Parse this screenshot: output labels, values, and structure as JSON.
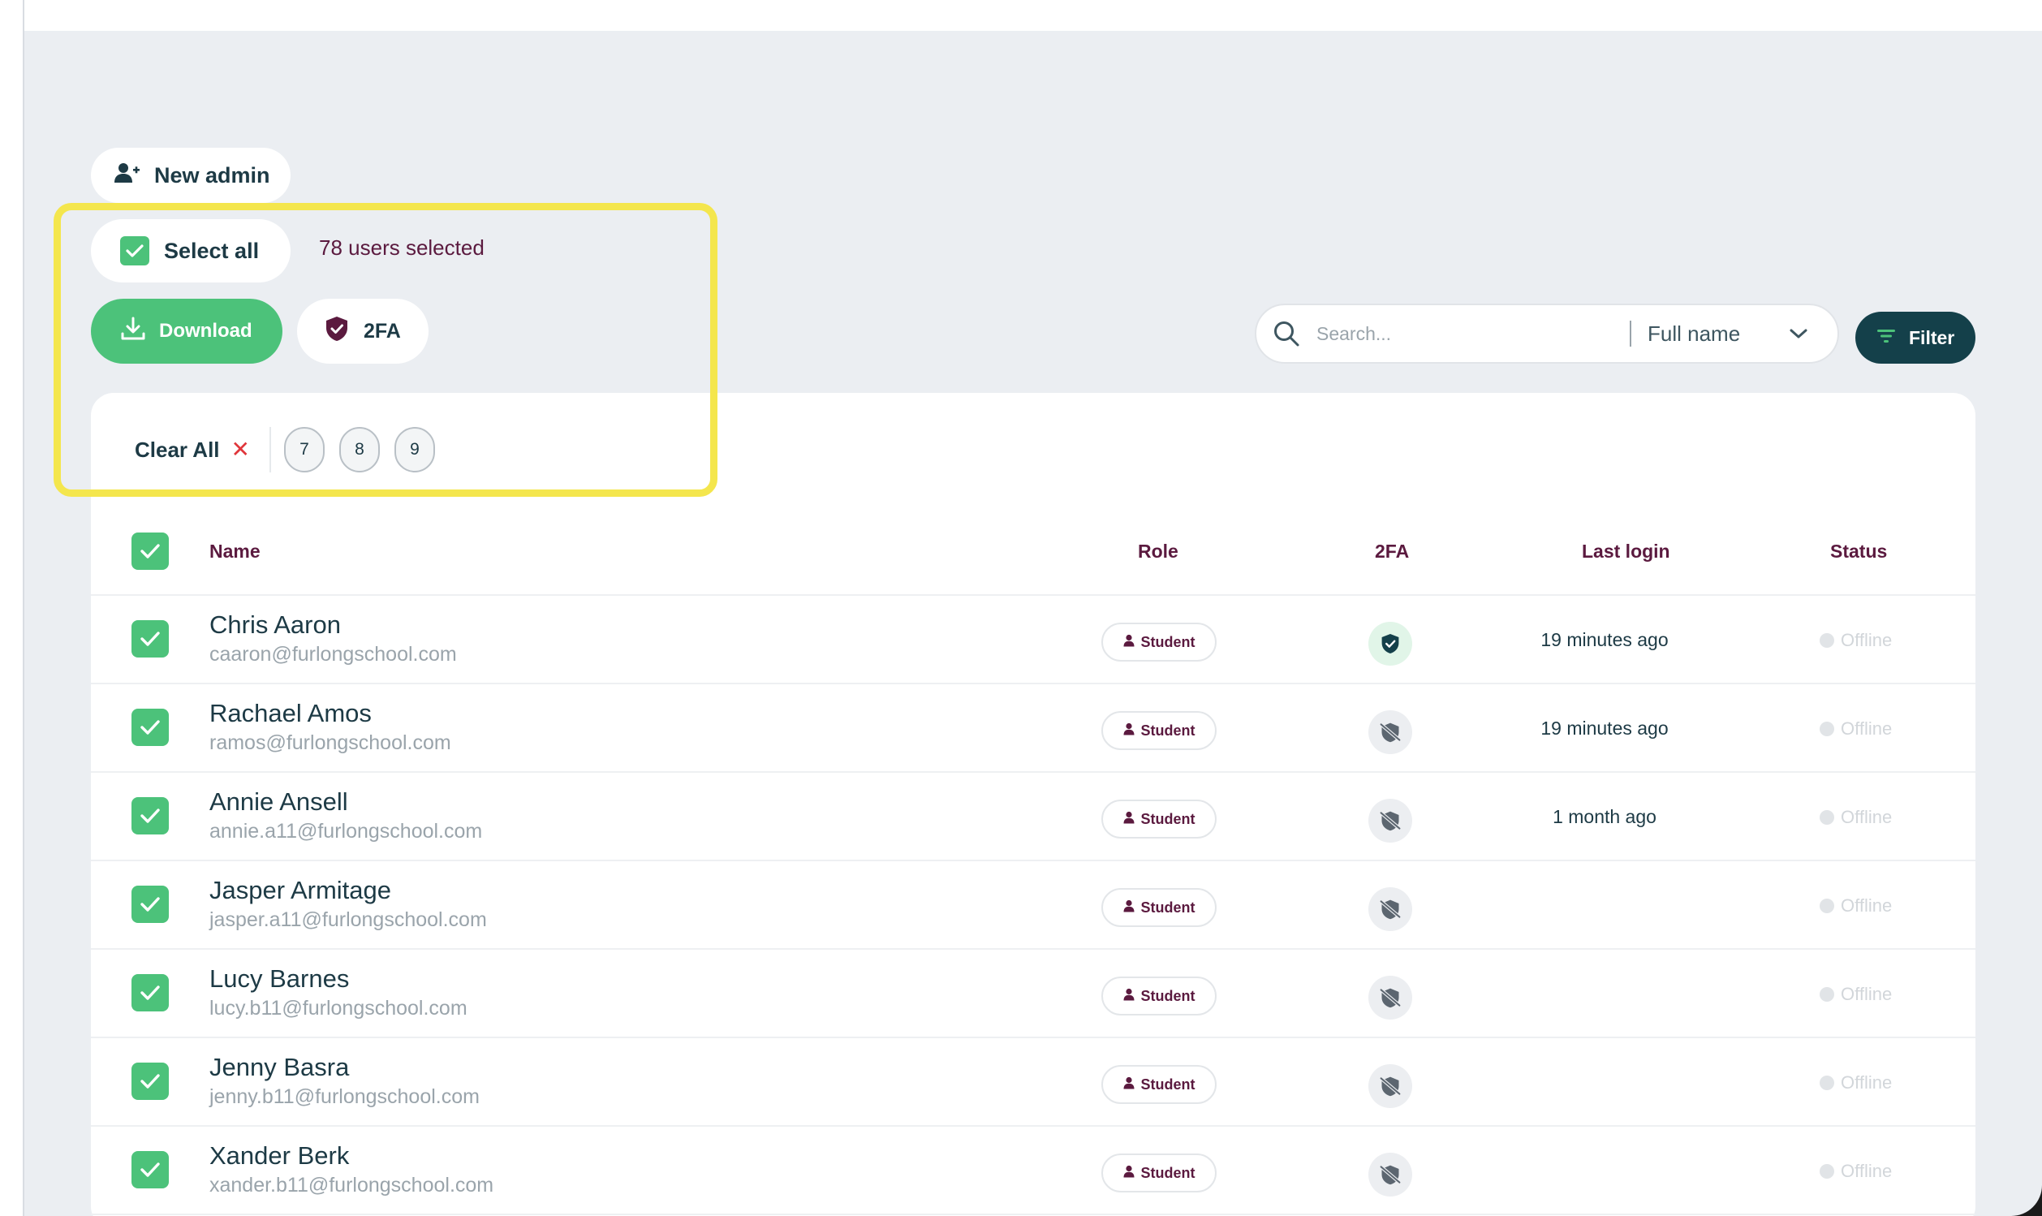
{
  "toolbar": {
    "new_admin_label": "New admin",
    "select_all_label": "Select all",
    "selected_count": "78 users selected",
    "download_label": "Download",
    "twofa_label": "2FA"
  },
  "search": {
    "placeholder": "Search...",
    "field": "Full name",
    "filter_label": "Filter"
  },
  "chips": {
    "clear_all_label": "Clear All",
    "items": [
      "7",
      "8",
      "9"
    ]
  },
  "table": {
    "headers": {
      "name": "Name",
      "role": "Role",
      "twofa": "2FA",
      "last_login": "Last login",
      "status": "Status"
    },
    "rows": [
      {
        "name": "Chris Aaron",
        "email": "caaron@furlongschool.com",
        "role": "Student",
        "twofa": "enabled",
        "last_login": "19 minutes ago",
        "status": "Offline"
      },
      {
        "name": "Rachael Amos",
        "email": "ramos@furlongschool.com",
        "role": "Student",
        "twofa": "disabled",
        "last_login": "19 minutes ago",
        "status": "Offline"
      },
      {
        "name": "Annie Ansell",
        "email": "annie.a11@furlongschool.com",
        "role": "Student",
        "twofa": "disabled",
        "last_login": "1 month ago",
        "status": "Offline"
      },
      {
        "name": "Jasper Armitage",
        "email": "jasper.a11@furlongschool.com",
        "role": "Student",
        "twofa": "disabled",
        "last_login": "",
        "status": "Offline"
      },
      {
        "name": "Lucy Barnes",
        "email": "lucy.b11@furlongschool.com",
        "role": "Student",
        "twofa": "disabled",
        "last_login": "",
        "status": "Offline"
      },
      {
        "name": "Jenny Basra",
        "email": "jenny.b11@furlongschool.com",
        "role": "Student",
        "twofa": "disabled",
        "last_login": "",
        "status": "Offline"
      },
      {
        "name": "Xander Berk",
        "email": "xander.b11@furlongschool.com",
        "role": "Student",
        "twofa": "disabled",
        "last_login": "",
        "status": "Offline"
      }
    ]
  },
  "colors": {
    "accent_green": "#4cc27a",
    "dark_teal": "#14404a",
    "plum": "#5b1a3f",
    "highlight_yellow": "#f4e64d"
  },
  "icons": {
    "new_admin": "user-plus-icon",
    "select_all": "checkbox-checked-icon",
    "download": "download-icon",
    "twofa": "shield-check-icon",
    "search": "search-icon",
    "dropdown": "chevron-down-icon",
    "filter": "filter-lines-icon",
    "clear": "close-icon",
    "role": "person-icon",
    "twofa_off": "shield-off-icon"
  }
}
